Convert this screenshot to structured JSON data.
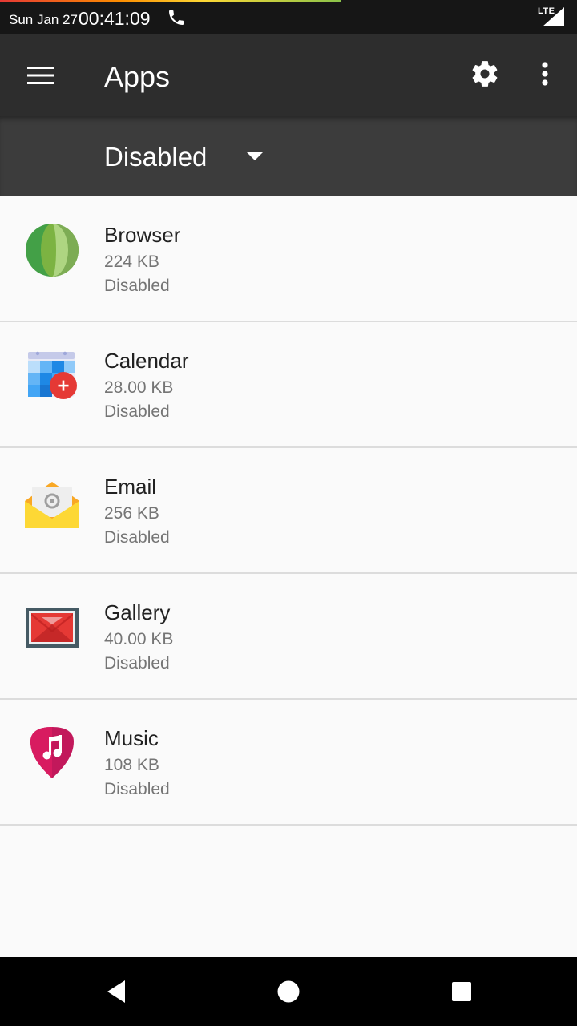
{
  "status_bar": {
    "date": "Sun Jan 27",
    "time": "00:41:09",
    "network": "LTE"
  },
  "app_bar": {
    "title": "Apps",
    "icons": [
      "menu-icon",
      "gear-icon",
      "more-vert-icon"
    ]
  },
  "filter": {
    "selected": "Disabled"
  },
  "apps": [
    {
      "name": "Browser",
      "size": "224 KB",
      "status": "Disabled",
      "icon": "browser-icon"
    },
    {
      "name": "Calendar",
      "size": "28.00 KB",
      "status": "Disabled",
      "icon": "calendar-icon"
    },
    {
      "name": "Email",
      "size": "256 KB",
      "status": "Disabled",
      "icon": "email-icon"
    },
    {
      "name": "Gallery",
      "size": "40.00 KB",
      "status": "Disabled",
      "icon": "gallery-icon"
    },
    {
      "name": "Music",
      "size": "108 KB",
      "status": "Disabled",
      "icon": "music-icon"
    }
  ],
  "nav_bar": {
    "icons": [
      "back-icon",
      "home-icon",
      "recents-icon"
    ]
  },
  "colors": {
    "status_bar": "#161616",
    "app_bar": "#2d2d2d",
    "filter_bar": "#3c3c3c",
    "background": "#fafafa",
    "secondary_text": "#757575"
  }
}
